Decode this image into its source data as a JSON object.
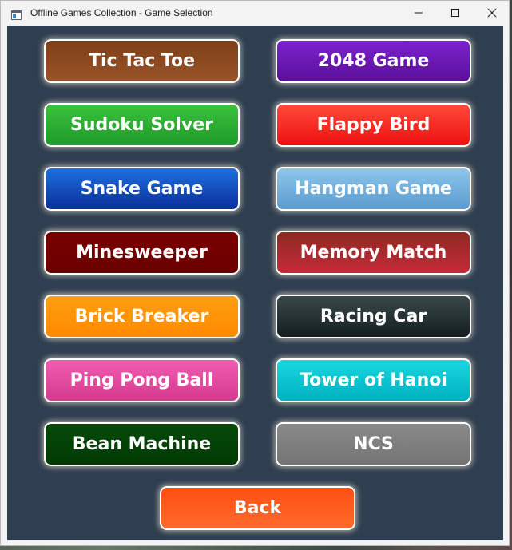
{
  "window": {
    "title": "Offline Games Collection - Game Selection",
    "app_icon": "window-app-icon",
    "controls": [
      "minimize-icon",
      "maximize-icon",
      "close-icon"
    ]
  },
  "games": [
    {
      "label": "Tic Tac Toe",
      "color": "#8b4a22"
    },
    {
      "label": "2048 Game",
      "color": "#6a16b8"
    },
    {
      "label": "Sudoku Solver",
      "color": "#2cb034"
    },
    {
      "label": "Flappy Bird",
      "color": "#f52a22"
    },
    {
      "label": "Snake Game",
      "color": "#1450c8"
    },
    {
      "label": "Hangman Game",
      "color": "#74b2e0"
    },
    {
      "label": "Minesweeper",
      "color": "#720000"
    },
    {
      "label": "Memory Match",
      "color": "#a82a2e"
    },
    {
      "label": "Brick Breaker",
      "color": "#ff9508"
    },
    {
      "label": "Racing Car",
      "color": "#263436"
    },
    {
      "label": "Ping Pong Ball",
      "color": "#e44aa0"
    },
    {
      "label": "Tower of Hanoi",
      "color": "#0cc4d0"
    },
    {
      "label": "Bean Machine",
      "color": "#054208"
    },
    {
      "label": "NCS",
      "color": "#7f7f7f"
    }
  ],
  "back": {
    "label": "Back",
    "color": "#ff5a1e"
  },
  "colors": {
    "client_background": "#2f3e50",
    "button_border": "#ffffff",
    "titlebar": "#f3f3f3"
  }
}
